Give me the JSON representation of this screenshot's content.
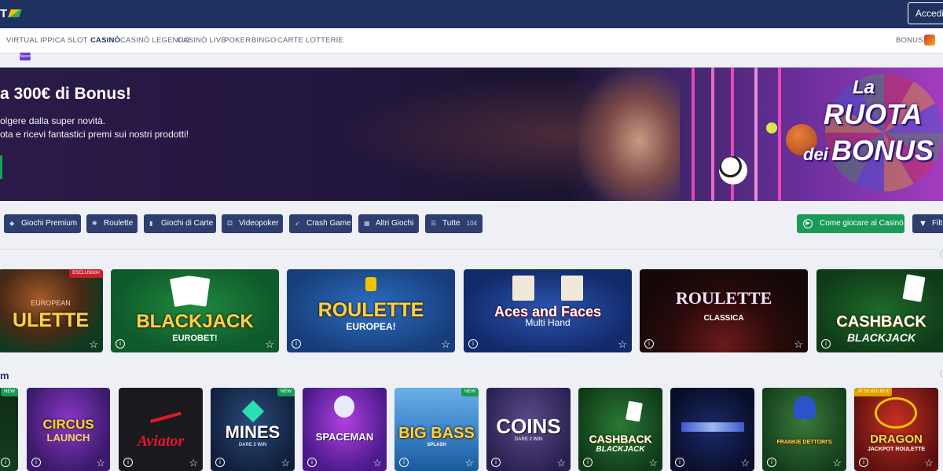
{
  "header": {
    "logo_text": "T",
    "login_label": "Accedi"
  },
  "nav": {
    "new_badge": "Nuovo!",
    "items": [
      "VIRTUAL",
      "IPPICA",
      "SLOT",
      "CASINÒ",
      "CASINÒ LEGENDO",
      "CASINÒ LIVE",
      "POKER",
      "BINGO",
      "CARTE",
      "LOTTERIE"
    ],
    "active": "CASINÒ",
    "right_label": "BONUS"
  },
  "hero": {
    "title": "a 300€ di Bonus!",
    "line1": "olgere dalla super novità.",
    "line2": "ota e ricevi fantastici premi sui nostri prodotti!",
    "ruota_la": "La",
    "ruota_ruota": "RUOTA",
    "ruota_dei": "dei",
    "ruota_bonus": "BONUS"
  },
  "filters": [
    {
      "label": "Giochi Premium",
      "icon": "diamond-icon"
    },
    {
      "label": "Roulette",
      "icon": "roulette-icon"
    },
    {
      "label": "Giochi di Carte",
      "icon": "cards-icon"
    },
    {
      "label": "Videopoker",
      "icon": "dice-icon"
    },
    {
      "label": "Crash Game",
      "icon": "rocket-icon"
    },
    {
      "label": "Altri Giochi",
      "icon": "grid-icon"
    },
    {
      "label": "Tutte",
      "icon": "list-icon",
      "count": "104"
    }
  ],
  "actions": {
    "how_to_play": "Come giocare al Casinò",
    "filter": "Filtri"
  },
  "section_label": "m",
  "row1": [
    {
      "title": "ULETTE",
      "sub": "EUROPEAN",
      "badge": "ESCLUSIVA!"
    },
    {
      "title": "BLACKJACK",
      "sub": "EUROBET!"
    },
    {
      "title": "ROULETTE",
      "sub": "EUROPEA!"
    },
    {
      "title": "Aces and Faces",
      "sub": "Multi Hand"
    },
    {
      "title": "ROULETTE",
      "sub": "CLASSICA"
    },
    {
      "title": "CASHBACK",
      "sub": "BLACKJACK"
    }
  ],
  "row2": [
    {
      "title": "",
      "badge": "NEW"
    },
    {
      "title": "CIRCUS",
      "sub": "LAUNCH"
    },
    {
      "title": "Aviator",
      "sub": ""
    },
    {
      "title": "MINES",
      "sub": "DARE 2 WIN",
      "badge": "NEW"
    },
    {
      "title": "SPACEMAN",
      "sub": ""
    },
    {
      "title": "BIG BASS",
      "sub": "SPLASH",
      "badge": "NEW"
    },
    {
      "title": "COINS",
      "sub": "DARE 2 WIN"
    },
    {
      "title": "CASHBACK",
      "sub": "BLACKJACK"
    },
    {
      "title": "",
      "sub": ""
    },
    {
      "title": "FRANKIE DETTORI'S",
      "sub": ""
    },
    {
      "title": "DRAGON",
      "sub": "JACKPOT ROULETTE",
      "badge": "JP 50.810,62 €"
    }
  ]
}
